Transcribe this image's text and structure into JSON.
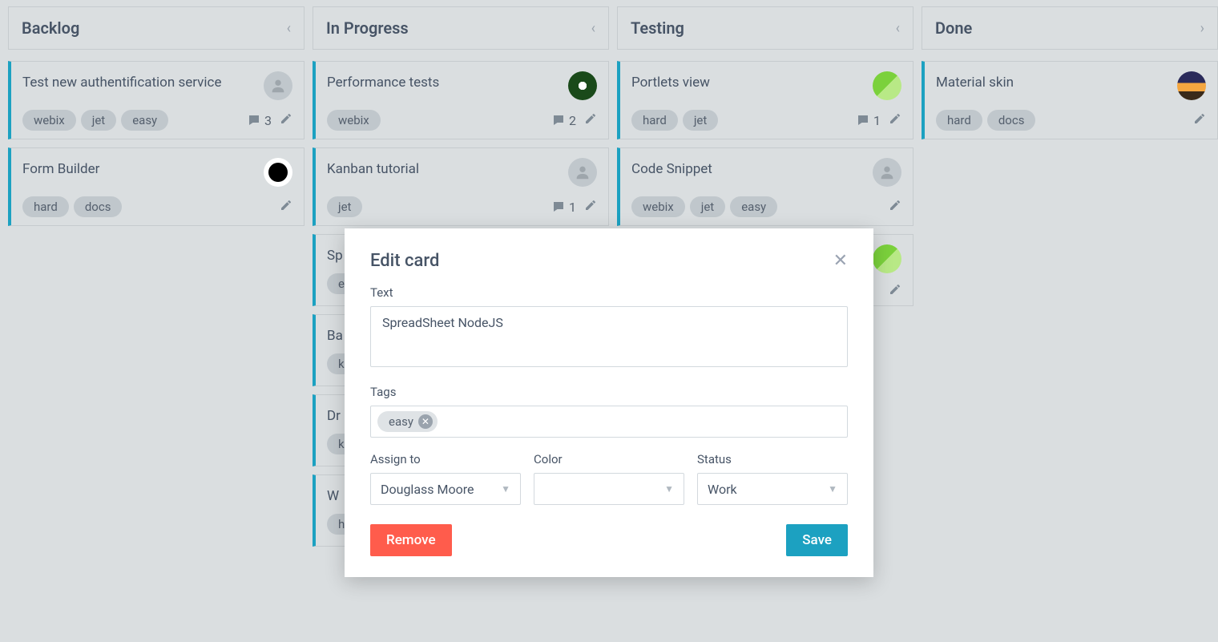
{
  "columns": [
    {
      "title": "Backlog",
      "chevron": "left",
      "cards": [
        {
          "title": "Test new authentification service",
          "tags": [
            "webix",
            "jet",
            "easy"
          ],
          "avatar": "default",
          "comments": 3,
          "edit": true
        },
        {
          "title": "Form Builder",
          "tags": [
            "hard",
            "docs"
          ],
          "avatar": "img4",
          "comments": null,
          "edit": true
        }
      ]
    },
    {
      "title": "In Progress",
      "chevron": "left",
      "cards": [
        {
          "title": "Performance tests",
          "tags": [
            "webix"
          ],
          "avatar": "img1",
          "comments": 2,
          "edit": true
        },
        {
          "title": "Kanban tutorial",
          "tags": [
            "jet"
          ],
          "avatar": "default",
          "comments": 1,
          "edit": true
        },
        {
          "title": "Sp",
          "tags": [
            "e"
          ],
          "avatar": null,
          "comments": null,
          "edit": false,
          "partial": true
        },
        {
          "title": "Ba",
          "tags": [
            "ka"
          ],
          "avatar": null,
          "comments": null,
          "edit": false,
          "partial": true
        },
        {
          "title": "Dr",
          "tags": [
            "ka"
          ],
          "avatar": null,
          "comments": null,
          "edit": false,
          "partial": true
        },
        {
          "title": "W",
          "tags": [
            "h"
          ],
          "avatar": null,
          "comments": null,
          "edit": false,
          "partial": true
        }
      ]
    },
    {
      "title": "Testing",
      "chevron": "left",
      "cards": [
        {
          "title": "Portlets view",
          "tags": [
            "hard",
            "jet"
          ],
          "avatar": "img2",
          "comments": 1,
          "edit": true
        },
        {
          "title": "Code Snippet",
          "tags": [
            "webix",
            "jet",
            "easy"
          ],
          "avatar": "default",
          "comments": null,
          "edit": true
        },
        {
          "title": "",
          "tags": [],
          "avatar": "img2",
          "comments": null,
          "edit": true,
          "partial": true,
          "stub": true
        }
      ]
    },
    {
      "title": "Done",
      "chevron": "right",
      "cards": [
        {
          "title": "Material skin",
          "tags": [
            "hard",
            "docs"
          ],
          "avatar": "img3",
          "comments": null,
          "edit": true
        }
      ]
    }
  ],
  "modal": {
    "title": "Edit card",
    "fields": {
      "text_label": "Text",
      "text_value": "SpreadSheet NodeJS",
      "tags_label": "Tags",
      "tags_value": [
        "easy"
      ],
      "assign_label": "Assign to",
      "assign_value": "Douglass Moore",
      "color_label": "Color",
      "color_value": "",
      "status_label": "Status",
      "status_value": "Work"
    },
    "buttons": {
      "remove": "Remove",
      "save": "Save"
    }
  }
}
